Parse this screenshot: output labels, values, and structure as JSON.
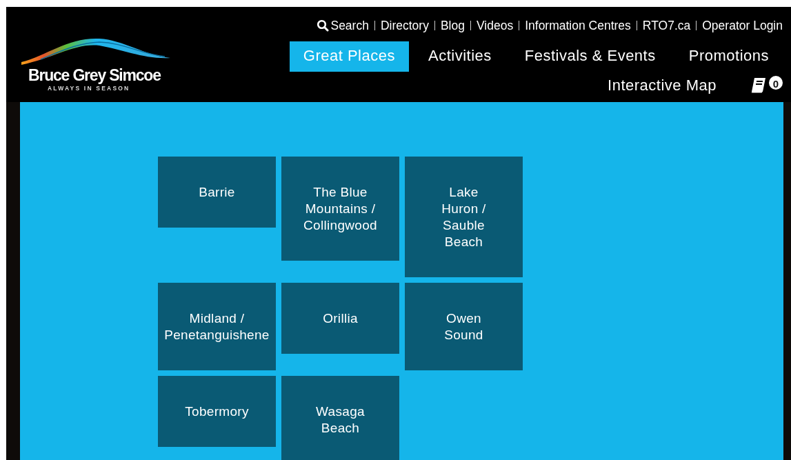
{
  "logo": {
    "name": "Bruce Grey Simcoe",
    "tagline": "ALWAYS IN SEASON"
  },
  "utility_links": [
    {
      "label": "Search",
      "kind": "search"
    },
    {
      "label": "Directory",
      "kind": "link"
    },
    {
      "label": "Blog",
      "kind": "link"
    },
    {
      "label": "Videos",
      "kind": "link"
    },
    {
      "label": "Information Centres",
      "kind": "link"
    },
    {
      "label": "RTO7.ca",
      "kind": "link"
    },
    {
      "label": "Operator Login",
      "kind": "link"
    }
  ],
  "main_nav": [
    {
      "label": "Great Places",
      "selected": true
    },
    {
      "label": "Activities",
      "selected": false
    },
    {
      "label": "Festivals & Events",
      "selected": false
    },
    {
      "label": "Promotions",
      "selected": false
    },
    {
      "label": "Interactive Map",
      "selected": false
    }
  ],
  "trip_badge": {
    "count": "0"
  },
  "places": [
    "Barrie",
    "The Blue\nMountains /\nCollingwood",
    "Lake\nHuron /\nSauble\nBeach",
    "Midland /\nPenetanguishene",
    "Orillia",
    "Owen\nSound",
    "Tobermory",
    "Wasaga\nBeach"
  ]
}
